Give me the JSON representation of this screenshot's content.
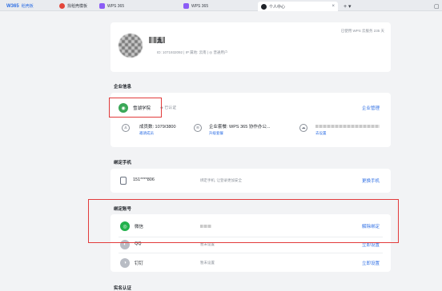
{
  "tabs": [
    {
      "label": "稻壳板",
      "brand": "W365"
    },
    {
      "label": "找稻壳模板"
    },
    {
      "label": "WPS 365"
    },
    {
      "label": "WPS 365"
    },
    {
      "label": "个人中心",
      "close": "×"
    }
  ],
  "tabbar": {
    "add": "+ ▾",
    "right_icon": "▢"
  },
  "profile": {
    "name": "九",
    "meta": "ID: 1071932092 | IP 属地: 云南 | ◎ 普通用户",
    "right_text": "已使用 WPS 云服务 235 天"
  },
  "enterprise": {
    "section_title": "企业信息",
    "name": "雪湖学院",
    "cert": "已认证",
    "manage_link": "企业管理",
    "members_label": "成员数: 1079/3800",
    "members_link": "邀请成员",
    "package_label": "企业套餐: WPS 365 协作办公...",
    "package_link": "升级套餐",
    "domain_link": "去设置"
  },
  "phone": {
    "section_title": "绑定手机",
    "number": "151****806",
    "desc": "绑定手机, 让登录更加安全",
    "action": "更换手机"
  },
  "accounts": {
    "section_title": "绑定账号",
    "items": [
      {
        "name": "微信",
        "desc": "",
        "action": "解除绑定"
      },
      {
        "name": "QQ",
        "desc": "暂未设置",
        "action": "立即设置"
      },
      {
        "name": "钉钉",
        "desc": "暂未设置",
        "action": "立即设置"
      }
    ]
  },
  "bottom_section": {
    "title": "实名认证"
  },
  "colors": {
    "accent": "#2f6fe4",
    "highlight": "#e23b3b",
    "wechat": "#22b14c",
    "enterprise": "#3aa757"
  }
}
